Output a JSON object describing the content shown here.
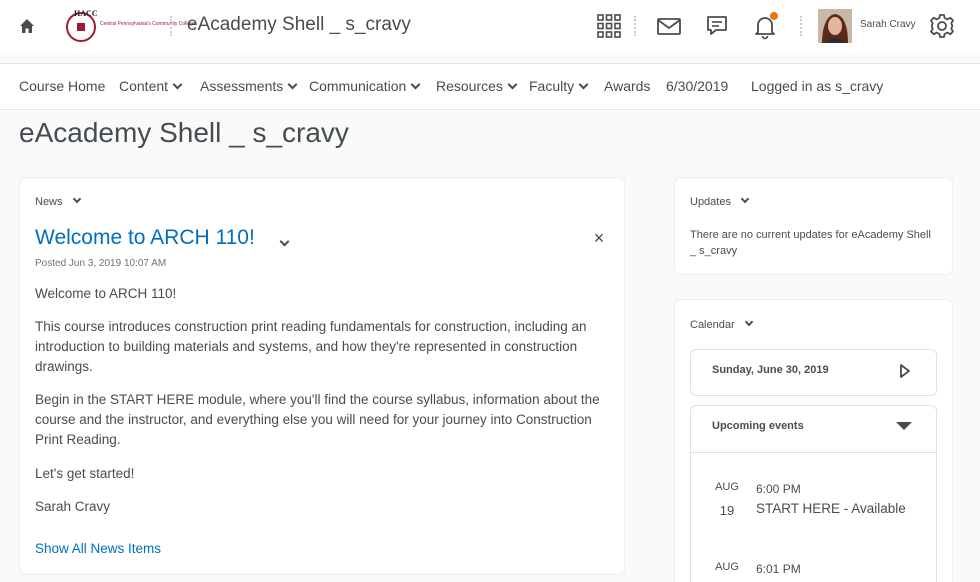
{
  "header": {
    "logo_text": "HACC",
    "logo_subtext": "Central Pennsylvania's Community College",
    "course_title": "eAcademy Shell _ s_cravy",
    "user_name": "Sarah Cravy",
    "icons": [
      "home-icon",
      "grid-icon",
      "mail-icon",
      "chat-icon",
      "bell-icon",
      "gear-icon"
    ],
    "notification_color": "#e87511"
  },
  "nav": {
    "items": [
      {
        "label": "Course Home",
        "dropdown": false
      },
      {
        "label": "Content",
        "dropdown": true
      },
      {
        "label": "Assessments",
        "dropdown": true
      },
      {
        "label": "Communication",
        "dropdown": true
      },
      {
        "label": "Resources",
        "dropdown": true
      },
      {
        "label": "Faculty",
        "dropdown": true
      },
      {
        "label": "Awards",
        "dropdown": false
      },
      {
        "label": "6/30/2019",
        "dropdown": false
      },
      {
        "label": "Logged in as s_cravy",
        "dropdown": false
      }
    ]
  },
  "page": {
    "title": "eAcademy Shell _ s_cravy"
  },
  "news": {
    "widget_title": "News",
    "item_title": "Welcome to ARCH 110!",
    "posted": "Posted Jun 3, 2019 10:07 AM",
    "paragraphs": [
      "Welcome to ARCH 110!",
      "This course introduces construction print reading fundamentals for construction, including an introduction to building materials and systems, and how they're represented in construction drawings.",
      "Begin in the START HERE module, where you'll find the course syllabus, information about the course and the instructor, and everything else you will need for your journey into Construction Print Reading.",
      "Let's get started!",
      "Sarah Cravy"
    ],
    "show_all": "Show All News Items",
    "link_color": "#006fbf"
  },
  "updates": {
    "widget_title": "Updates",
    "text": "There are no current updates for eAcademy Shell _ s_cravy"
  },
  "calendar": {
    "widget_title": "Calendar",
    "date": "Sunday, June 30, 2019",
    "upcoming_label": "Upcoming events",
    "events": [
      {
        "month": "AUG",
        "day": "19",
        "time": "6:00 PM",
        "title": "START HERE - Available"
      },
      {
        "month": "AUG",
        "day": "",
        "time": "6:01 PM",
        "title": ""
      }
    ]
  }
}
